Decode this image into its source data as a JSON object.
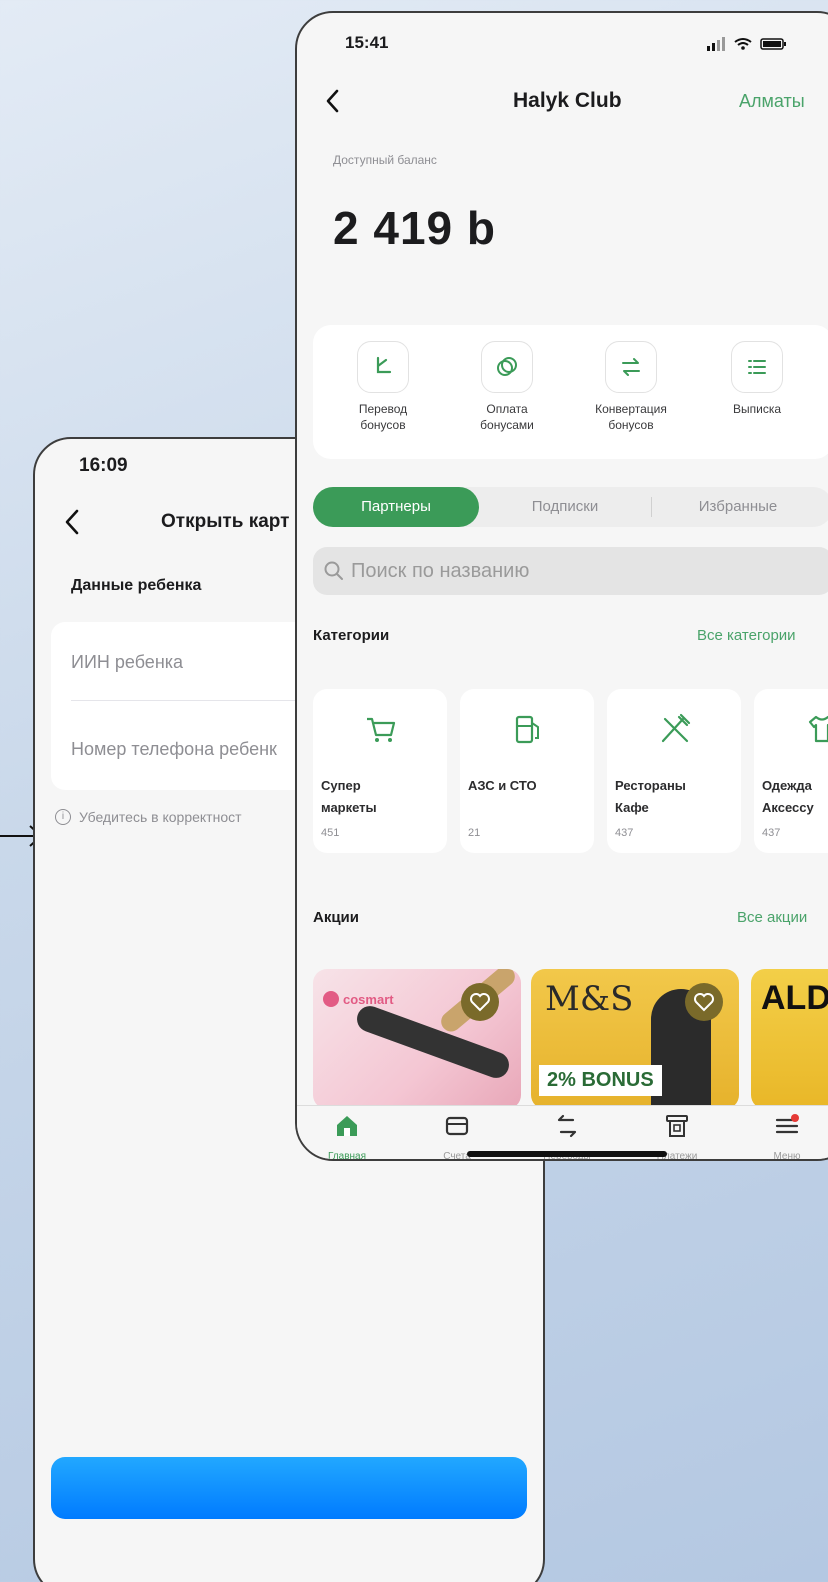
{
  "colors": {
    "accent_green": "#3b9b58",
    "link_green": "#4aa36a",
    "cta_blue": "#0a8cff",
    "badge_red": "#e53935"
  },
  "back_screen": {
    "time": "16:09",
    "title": "Открыть карт",
    "section": "Данные ребенка",
    "field_iin": "ИИН ребенка",
    "field_phone": "Номер телефона ребенк",
    "hint": "Убедитесь в корректност"
  },
  "front_screen": {
    "time": "15:41",
    "title": "Halyk Club",
    "city": "Алматы",
    "balance_label": "Доступный баланс",
    "balance": "2 419 b",
    "actions": [
      {
        "label": "Перевод\nбонусов",
        "icon": "bonus-transfer-icon"
      },
      {
        "label": "Оплата\nбонусами",
        "icon": "coins-icon"
      },
      {
        "label": "Конвертация\nбонусов",
        "icon": "convert-arrows-icon"
      },
      {
        "label": "Выписка",
        "icon": "list-icon"
      }
    ],
    "tabs": [
      "Партнеры",
      "Подписки",
      "Избранные"
    ],
    "search_placeholder": "Поиск по названию",
    "categories_title": "Категории",
    "categories_all": "Все категории",
    "categories": [
      {
        "name": "Супер\nмаркеты",
        "count": "451",
        "icon": "cart-icon"
      },
      {
        "name": "АЗС и СТО",
        "count": "21",
        "icon": "fuel-icon"
      },
      {
        "name": "Рестораны\nКафе",
        "count": "437",
        "icon": "restaurant-icon"
      },
      {
        "name": "Одежда\nАксессу",
        "count": "437",
        "icon": "clothes-icon"
      }
    ],
    "promos_title": "Акции",
    "promos_all": "Все акции",
    "promos": [
      {
        "brand": "cosmart",
        "bonus": ""
      },
      {
        "brand": "M&S",
        "bonus": "2% BONUS"
      },
      {
        "brand": "ALD",
        "bonus": ""
      }
    ],
    "tabbar": [
      {
        "label": "Главная",
        "icon": "home-icon"
      },
      {
        "label": "Счета",
        "icon": "card-icon"
      },
      {
        "label": "Переводы",
        "icon": "transfer-icon"
      },
      {
        "label": "Платежи",
        "icon": "payment-icon"
      },
      {
        "label": "Меню",
        "icon": "menu-icon"
      }
    ]
  }
}
